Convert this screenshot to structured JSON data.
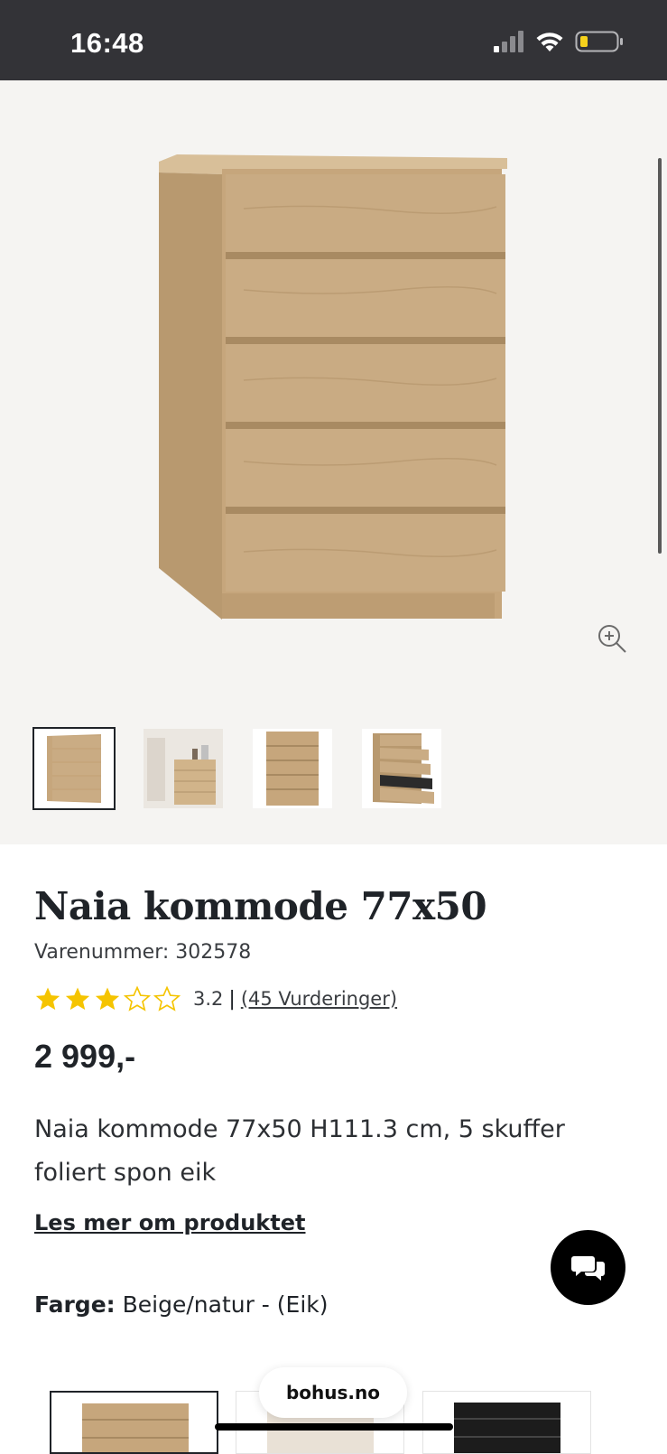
{
  "status": {
    "time": "16:48"
  },
  "product": {
    "title": "Naia kommode 77x50",
    "sku": "Varenummer: 302578",
    "rating_value": "3.2",
    "rating_separator": "|",
    "rating_count": "(45 Vurderinger)",
    "rating_stars": 3,
    "price": "2 999,-",
    "description": "Naia kommode 77x50 H111.3 cm, 5 skuffer foliert spon eik",
    "read_more": "Les mer om produktet",
    "color_label": "Farge:",
    "color_value": "Beige/natur - (Eik)"
  },
  "browser": {
    "url": "bohus.no"
  },
  "colors": {
    "accent_star": "#f5c400",
    "wood": "#c9ad86",
    "dark": "#1f2328"
  }
}
